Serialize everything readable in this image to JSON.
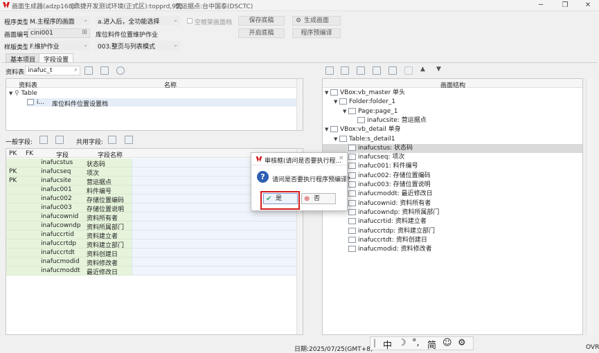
{
  "window": {
    "title_app": "画面生成器(adzp168)",
    "title_env": "[鼎捷开发测试环境(正式区):topprd,99]",
    "title_site": "营运据点:台中国泰(DSCTC)",
    "accent": "#d51a1a"
  },
  "toolbar": {
    "prog_type_label": "程序类型",
    "prog_type_value": "M.主程序的画面",
    "entry_value": "a.进入后，全功能选择",
    "empty_frame_label": "空框架画面档",
    "save_draft": "保存底稿",
    "gen_screen": "生成画面",
    "screen_no_label": "画面编号",
    "screen_no_value": "cini001",
    "screen_desc": "库位料件位置维护作业",
    "open_draft": "开启底稿",
    "precompile": "程序预编译",
    "sample_type_label": "样版类型",
    "sample_type_value": "F.维护作业",
    "mode_value": "003.整页与列表模式"
  },
  "tabs": [
    "基本项目",
    "字段设置"
  ],
  "left": {
    "table_label": "资料表",
    "table_value": "inafuc_t",
    "tree_headers": [
      "资料表",
      "名称"
    ],
    "tree_root": "Table",
    "tree_child_code": "i...",
    "tree_child_name": "库位料件位置设置档",
    "general_fields_label": "一般字段:",
    "shared_fields_label": "共用字段:",
    "grid_headers": [
      "PK",
      "FK",
      "字段",
      "字段名称"
    ],
    "rows": [
      {
        "pk": "",
        "field": "inafucstus",
        "name": "状态码"
      },
      {
        "pk": "PK",
        "field": "inafucseq",
        "name": "项次"
      },
      {
        "pk": "PK",
        "field": "inafucsite",
        "name": "营运据点"
      },
      {
        "pk": "",
        "field": "inafuc001",
        "name": "料件编号"
      },
      {
        "pk": "",
        "field": "inafuc002",
        "name": "存储位置编码"
      },
      {
        "pk": "",
        "field": "inafuc003",
        "name": "存储位置说明"
      },
      {
        "pk": "",
        "field": "inafucownid",
        "name": "资料所有者"
      },
      {
        "pk": "",
        "field": "inafucowndp",
        "name": "资料所属部门"
      },
      {
        "pk": "",
        "field": "inafuccrtid",
        "name": "资料建立者"
      },
      {
        "pk": "",
        "field": "inafuccrtdp",
        "name": "资料建立部门"
      },
      {
        "pk": "",
        "field": "inafuccrtdt",
        "name": "资料创建日"
      },
      {
        "pk": "",
        "field": "inafucmodid",
        "name": "资料修改者"
      },
      {
        "pk": "",
        "field": "inafucmoddt",
        "name": "最近修改日"
      }
    ]
  },
  "right": {
    "header": "画面结构",
    "tree": [
      {
        "level": 0,
        "text": "VBox:vb_master 单头",
        "exp": "▼"
      },
      {
        "level": 1,
        "text": "Folder:folder_1",
        "exp": "▼"
      },
      {
        "level": 2,
        "text": "Page:page_1",
        "exp": "▼"
      },
      {
        "level": 3,
        "text": "inafucsite: 营运据点",
        "exp": ""
      },
      {
        "level": 0,
        "text": "VBox:vb_detail 单身",
        "exp": "▼"
      },
      {
        "level": 1,
        "text": "Table:s_detail1",
        "exp": "▼"
      },
      {
        "level": 2,
        "text": "inafucstus: 状态码",
        "exp": "",
        "sel": true
      },
      {
        "level": 2,
        "text": "inafucseq: 项次",
        "exp": ""
      },
      {
        "level": 2,
        "text": "inafuc001: 料件编号",
        "exp": ""
      },
      {
        "level": 2,
        "text": "inafuc002: 存储位置编码",
        "exp": ""
      },
      {
        "level": 2,
        "text": "inafuc003: 存储位置说明",
        "exp": ""
      },
      {
        "level": 2,
        "text": "inafucmoddt: 最近修改日",
        "exp": ""
      },
      {
        "level": 2,
        "text": "inafucownid: 资料所有者",
        "exp": ""
      },
      {
        "level": 2,
        "text": "inafucowndp: 资料所属部门",
        "exp": ""
      },
      {
        "level": 2,
        "text": "inafuccrtid: 资料建立者",
        "exp": ""
      },
      {
        "level": 2,
        "text": "inafuccrtdp: 资料建立部门",
        "exp": ""
      },
      {
        "level": 2,
        "text": "inafuccrtdt: 资料创建日",
        "exp": ""
      },
      {
        "level": 2,
        "text": "inafucmodid: 资料修改者",
        "exp": ""
      }
    ]
  },
  "dialog": {
    "title": "审核框(请问是否要执行程...",
    "message": "请问是否要执行程序预编译?",
    "yes": "是",
    "no": "否"
  },
  "status": {
    "date": "日期:2025/07/25(GMT+8)",
    "ovr": "OVR"
  },
  "ime": {
    "cn": "中",
    "jian": "简"
  }
}
